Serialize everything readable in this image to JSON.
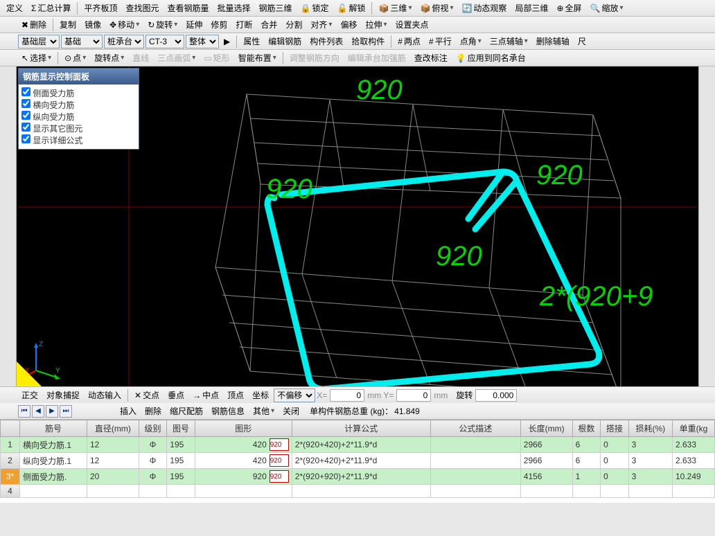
{
  "toolbars": {
    "row1": {
      "items": [
        "定义",
        "汇总计算",
        "平齐板顶",
        "查找图元",
        "查看钢筋量",
        "批量选择",
        "钢筋三维",
        "锁定",
        "解锁",
        "三维",
        "俯视",
        "动态观察",
        "局部三维",
        "全屏",
        "缩放"
      ]
    },
    "row2": {
      "items": [
        "删除",
        "复制",
        "镜像",
        "移动",
        "旋转",
        "延伸",
        "修剪",
        "打断",
        "合并",
        "分割",
        "对齐",
        "偏移",
        "拉伸",
        "设置夹点"
      ]
    },
    "row3": {
      "selects": {
        "layer": "基础层",
        "type": "基础",
        "sub": "桩承台",
        "code": "CT-3",
        "mode": "整体"
      },
      "items": [
        "属性",
        "编辑钢筋",
        "构件列表",
        "拾取构件",
        "两点",
        "平行",
        "点角",
        "三点辅轴",
        "删除辅轴",
        "尺"
      ]
    },
    "row4": {
      "items": [
        "选择",
        "点",
        "旋转点",
        "直线",
        "三点画弧",
        "矩形",
        "智能布置",
        "调整钢筋方向",
        "编辑承台加强筋",
        "查改标注",
        "应用到同名承台"
      ]
    }
  },
  "panel": {
    "title": "钢筋显示控制面板",
    "opts": [
      "侧面受力筋",
      "横向受力筋",
      "纵向受力筋",
      "显示其它图元",
      "显示详细公式"
    ]
  },
  "dims": {
    "d1": "920",
    "d2": "920",
    "d3": "920",
    "d4": "920",
    "formula": "2*(920+9"
  },
  "axis": {
    "x": "X",
    "y": "Y",
    "z": "Z"
  },
  "status": {
    "items": [
      "正交",
      "对象捕捉",
      "动态输入",
      "交点",
      "垂点",
      "中点",
      "顶点",
      "坐标"
    ],
    "offset_sel": "不偏移",
    "x_lbl": "X=",
    "x_val": "0",
    "y_lbl": "mm Y=",
    "y_val": "0",
    "mm": "mm",
    "rot_lbl": "旋转",
    "rot_val": "0.000"
  },
  "nav": {
    "items": [
      "插入",
      "删除",
      "缩尺配筋",
      "钢筋信息",
      "其他",
      "关闭"
    ],
    "weight_lbl": "单构件钢筋总重 (kg)：",
    "weight_val": "41.849"
  },
  "grid": {
    "headers": [
      "筋号",
      "直径(mm)",
      "级别",
      "图号",
      "图形",
      "计算公式",
      "公式描述",
      "长度(mm)",
      "根数",
      "搭接",
      "损耗(%)",
      "单重(kg"
    ],
    "rows": [
      {
        "n": "1",
        "name": "横向受力筋.1",
        "dia": "12",
        "lvl": "Φ",
        "code": "195",
        "shape_pre": "420",
        "shape_in": "920",
        "formula": "2*(920+420)+2*11.9*d",
        "desc": "",
        "len": "2966",
        "cnt": "6",
        "lap": "0",
        "loss": "3",
        "wt": "2.633",
        "green": true
      },
      {
        "n": "2",
        "name": "纵向受力筋.1",
        "dia": "12",
        "lvl": "Φ",
        "code": "195",
        "shape_pre": "420",
        "shape_in": "920",
        "formula": "2*(920+420)+2*11.9*d",
        "desc": "",
        "len": "2966",
        "cnt": "6",
        "lap": "0",
        "loss": "3",
        "wt": "2.633",
        "green": false
      },
      {
        "n": "3*",
        "name": "侧面受力筋.",
        "dia": "20",
        "lvl": "Φ",
        "code": "195",
        "shape_pre": "920",
        "shape_in": "920",
        "formula": "2*(920+920)+2*11.9*d",
        "desc": "",
        "len": "4156",
        "cnt": "1",
        "lap": "0",
        "loss": "3",
        "wt": "10.249",
        "green": true,
        "sel": true
      },
      {
        "n": "4",
        "name": "",
        "dia": "",
        "lvl": "",
        "code": "",
        "shape_pre": "",
        "shape_in": "",
        "formula": "",
        "desc": "",
        "len": "",
        "cnt": "",
        "lap": "",
        "loss": "",
        "wt": "",
        "green": false
      }
    ]
  }
}
